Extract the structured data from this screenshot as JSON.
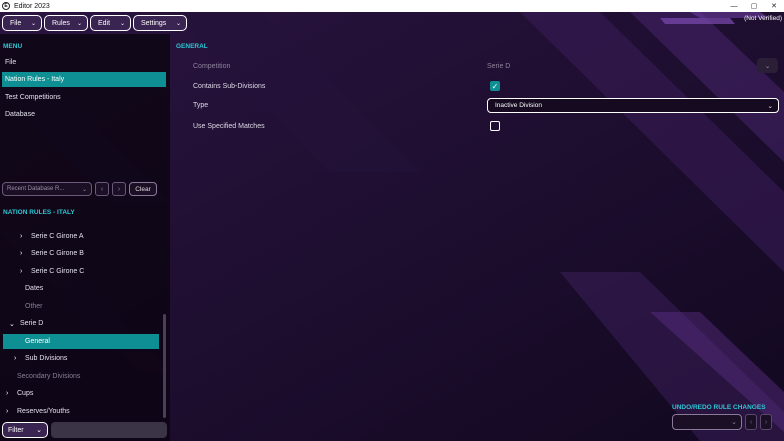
{
  "window": {
    "title": "Editor 2023",
    "app_icon": "E",
    "minimize_label": "—",
    "maximize_label": "▢",
    "close_label": "✕"
  },
  "topbar": {
    "menus": [
      {
        "label": "File"
      },
      {
        "label": "Rules"
      },
      {
        "label": "Edit"
      },
      {
        "label": "Settings"
      }
    ],
    "chevron": "⌄",
    "status": "(Not Verified)"
  },
  "menu": {
    "header": "MENU",
    "items": [
      {
        "label": "File",
        "selected": false
      },
      {
        "label": "Nation Rules - Italy",
        "selected": true
      },
      {
        "label": "Test Competitions",
        "selected": false
      },
      {
        "label": "Database",
        "selected": false
      }
    ]
  },
  "recent": {
    "select_label": "Recent Database R...",
    "chevron": "⌄",
    "prev_label": "‹",
    "next_label": "›",
    "clear_label": "Clear"
  },
  "tree": {
    "header": "NATION RULES - ITALY",
    "items": [
      {
        "label": "Serie C Girone A",
        "arrow": "›"
      },
      {
        "label": "Serie C Girone B",
        "arrow": "›"
      },
      {
        "label": "Serie C Girone C",
        "arrow": "›"
      },
      {
        "label": "Dates",
        "arrow": ""
      },
      {
        "label": "Other",
        "arrow": ""
      },
      {
        "label": "Serie D",
        "arrow": "⌄"
      },
      {
        "label": "General",
        "arrow": ""
      },
      {
        "label": "Sub Divisions",
        "arrow": "›"
      },
      {
        "label": "Secondary Divisions",
        "arrow": ""
      },
      {
        "label": "Cups",
        "arrow": "›"
      },
      {
        "label": "Reserves/Youths",
        "arrow": "›"
      }
    ]
  },
  "filter": {
    "label": "Filter",
    "chevron": "⌄"
  },
  "general": {
    "header": "GENERAL",
    "competition_label": "Competition",
    "competition_value": "Serie D",
    "competition_dropdown": "⌄",
    "contains_subdivisions_label": "Contains Sub-Divisions",
    "contains_subdivisions_checked": true,
    "check_mark": "✓",
    "type_label": "Type",
    "type_value": "Inactive Division",
    "type_chevron": "⌄",
    "use_specified_matches_label": "Use Specified Matches",
    "use_specified_matches_checked": false
  },
  "undo": {
    "header": "UNDO/REDO RULE CHANGES",
    "select_chevron": "⌄",
    "prev_label": "‹",
    "next_label": "›"
  },
  "colors": {
    "accent": "#2ec7d4",
    "selection": "#0e8f93",
    "background": "#160a22"
  }
}
